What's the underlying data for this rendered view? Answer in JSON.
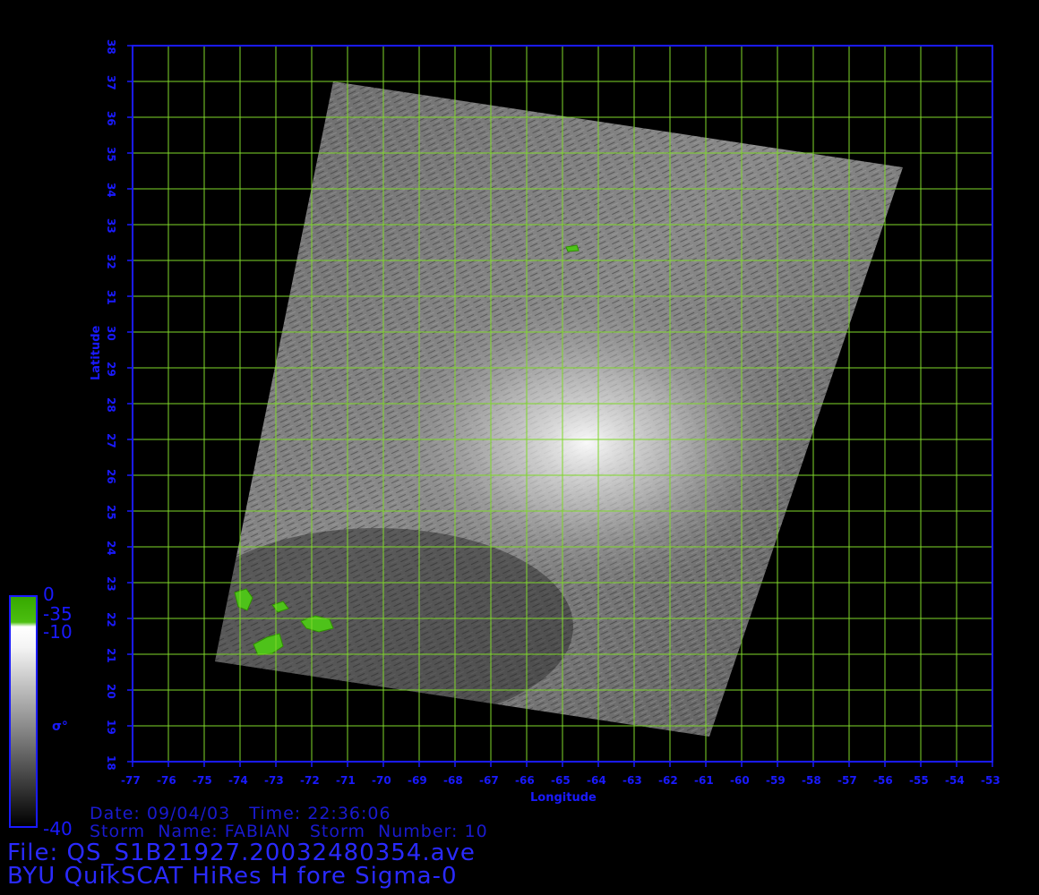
{
  "map": {
    "lon_ticks": [
      "-77",
      "-76",
      "-75",
      "-74",
      "-73",
      "-72",
      "-71",
      "-70",
      "-69",
      "-68",
      "-67",
      "-66",
      "-65",
      "-64",
      "-63",
      "-62",
      "-61",
      "-60",
      "-59",
      "-58",
      "-57",
      "-56",
      "-55",
      "-54",
      "-53"
    ],
    "lat_ticks": [
      "18",
      "19",
      "20",
      "21",
      "22",
      "23",
      "24",
      "25",
      "26",
      "27",
      "28",
      "29",
      "30",
      "31",
      "32",
      "33",
      "34",
      "35",
      "36",
      "37",
      "38"
    ],
    "xlabel": "Longitude",
    "ylabel": "Latitude",
    "lon_range": [
      -77,
      -53
    ],
    "lat_range": [
      18,
      38
    ],
    "grid_color": "#7fd82a",
    "axis_color": "#1a1aff",
    "swath_corners_lonlat": [
      [
        -71.4,
        37.0
      ],
      [
        -55.5,
        34.6
      ],
      [
        -60.9,
        18.7
      ],
      [
        -74.7,
        20.8
      ]
    ]
  },
  "colorbar": {
    "labels": [
      "0",
      "-35",
      "-10",
      "-40"
    ],
    "unit": "σ°"
  },
  "info": {
    "date_line": "Date: 09/04/03   Time: 22:36:06",
    "storm_line": "Storm  Name: FABIAN   Storm  Number: 10",
    "file_line": "File: QS_S1B21927.20032480354.ave",
    "product_line": "BYU QuikSCAT HiRes H fore Sigma-0"
  }
}
